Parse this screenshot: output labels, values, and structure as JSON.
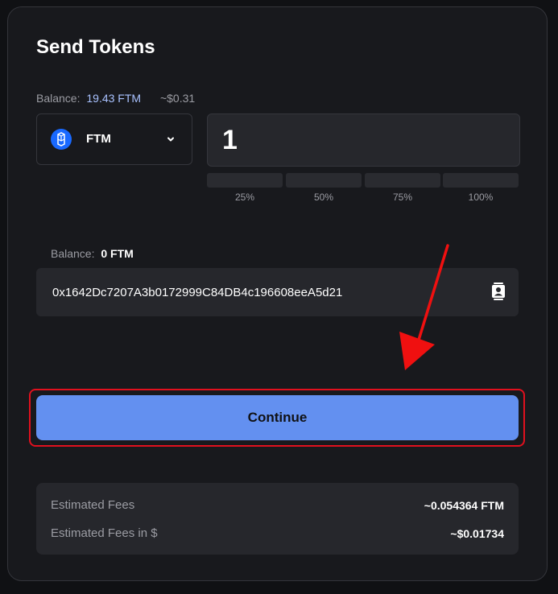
{
  "title": "Send Tokens",
  "source": {
    "balance_label": "Balance:",
    "balance_value": "19.43 FTM",
    "balance_usd": "~$0.31",
    "token": "FTM",
    "token_icon": "fantom-logo-icon",
    "amount": "1",
    "percent_options": [
      "25%",
      "50%",
      "75%",
      "100%"
    ]
  },
  "recipient": {
    "balance_label": "Balance:",
    "balance_value": "0 FTM",
    "address": "0x1642Dc7207A3b0172999C84DB4c196608eeA5d21",
    "address_book_icon": "contact-book-icon"
  },
  "continue_label": "Continue",
  "fees": {
    "estimated_label": "Estimated Fees",
    "estimated_value": "~0.054364 FTM",
    "estimated_usd_label": "Estimated Fees in $",
    "estimated_usd_value": "~$0.01734"
  },
  "colors": {
    "accent": "#6390f0",
    "highlight": "#e0101e",
    "token": "#1969ff"
  }
}
